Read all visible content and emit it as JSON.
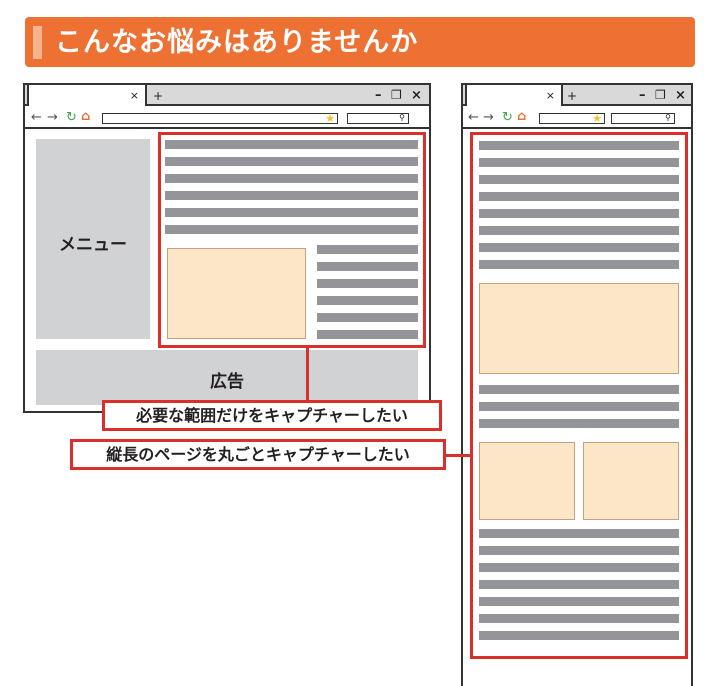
{
  "header": {
    "title": "こんなお悩みはありませんか"
  },
  "browser": {
    "tab_close": "×",
    "new_tab": "+",
    "minimize": "–",
    "maximize": "❐",
    "close": "×",
    "nav_back": "←",
    "nav_forward": "→",
    "nav_reload": "↻",
    "nav_home": "⌂"
  },
  "left_page": {
    "menu_label": "メニュー",
    "ad_label": "広告"
  },
  "callouts": {
    "partial": "必要な範囲だけをキャプチャーしたい",
    "full": "縦長のページを丸ごとキャプチャーしたい"
  },
  "colors": {
    "accent": "#ee7134",
    "highlight": "#d9302c",
    "placeholder": "#fde5c8",
    "text_line": "#939598"
  }
}
